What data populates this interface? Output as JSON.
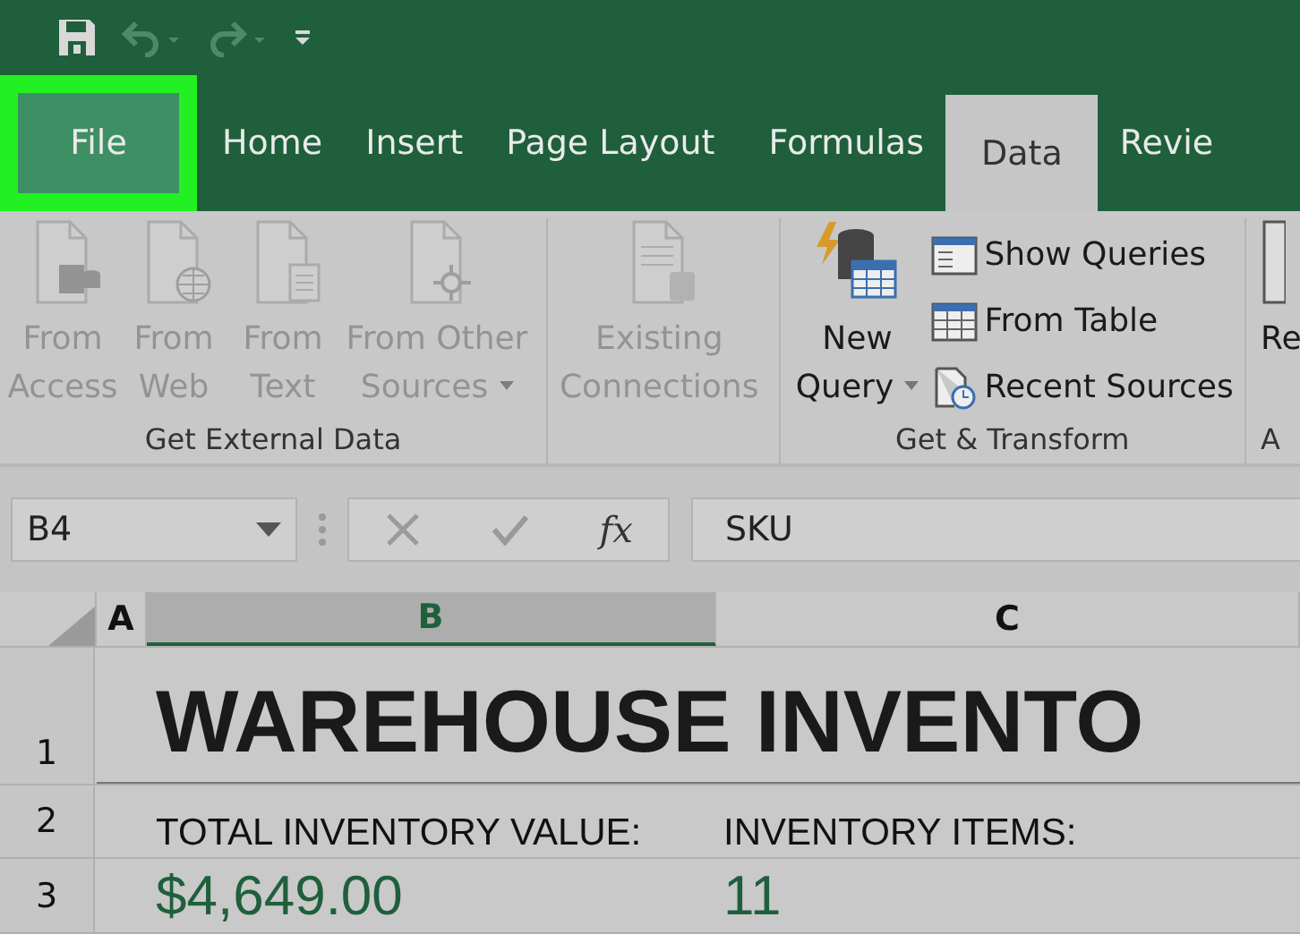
{
  "quick_access": [
    {
      "kind": "save",
      "disabled": false
    },
    {
      "kind": "undo",
      "disabled": true
    },
    {
      "kind": "redo",
      "disabled": true
    },
    {
      "kind": "customize",
      "disabled": false
    }
  ],
  "tabs": [
    {
      "label": "File",
      "selected": false,
      "highlighted": true
    },
    {
      "label": "Home",
      "selected": false,
      "highlighted": false
    },
    {
      "label": "Insert",
      "selected": false,
      "highlighted": false
    },
    {
      "label": "Page Layout",
      "selected": false,
      "highlighted": false
    },
    {
      "label": "Formulas",
      "selected": false,
      "highlighted": false
    },
    {
      "label": "Data",
      "selected": true,
      "highlighted": false
    },
    {
      "label": "Revie",
      "selected": false,
      "highlighted": false
    }
  ],
  "ribbon": {
    "groups": [
      {
        "label": "Get External Data",
        "buttons": [
          {
            "kind": "access",
            "label": "From Access",
            "disabled": true,
            "dropdown": false
          },
          {
            "kind": "web",
            "label": "From Web",
            "disabled": true,
            "dropdown": false
          },
          {
            "kind": "text",
            "label": "From Text",
            "disabled": true,
            "dropdown": false
          },
          {
            "kind": "other",
            "label": "From Other Sources",
            "disabled": true,
            "dropdown": true
          }
        ]
      },
      {
        "buttons": [
          {
            "kind": "connections",
            "label": "Existing Connections",
            "disabled": true,
            "dropdown": false
          }
        ]
      },
      {
        "label": "Get & Transform",
        "buttons": [
          {
            "kind": "query",
            "label": "New Query",
            "disabled": false,
            "dropdown": true
          },
          {
            "kind": "list",
            "items": [
              {
                "kind": "queries",
                "label": "Show Queries"
              },
              {
                "kind": "table",
                "label": "From Table"
              },
              {
                "kind": "recent",
                "label": "Recent Sources"
              }
            ]
          }
        ]
      },
      {
        "label": "A",
        "buttons": [
          {
            "kind": "refresh",
            "label": "Re",
            "disabled": false,
            "dropdown": false
          }
        ]
      }
    ]
  },
  "formula_bar": {
    "name_box": "B4",
    "fx": "fx",
    "formula": "SKU"
  },
  "sheet": {
    "columns": [
      {
        "label": "A",
        "selected": false
      },
      {
        "label": "B",
        "selected": true
      },
      {
        "label": "C",
        "selected": false
      }
    ],
    "rows": [
      {
        "header": "1",
        "cells": [
          {
            "kind": "empty",
            "text": ""
          },
          {
            "kind": "title",
            "text": "WAREHOUSE INVENTO"
          }
        ]
      },
      {
        "header": "2",
        "cells": [
          {
            "kind": "empty",
            "text": ""
          },
          {
            "kind": "label",
            "text": "TOTAL INVENTORY VALUE:"
          },
          {
            "kind": "label",
            "text": "INVENTORY ITEMS:"
          }
        ]
      },
      {
        "header": "3",
        "cells": [
          {
            "kind": "empty",
            "text": ""
          },
          {
            "kind": "value",
            "text": "$4,649.00"
          },
          {
            "kind": "value",
            "text": "11"
          }
        ]
      }
    ]
  }
}
